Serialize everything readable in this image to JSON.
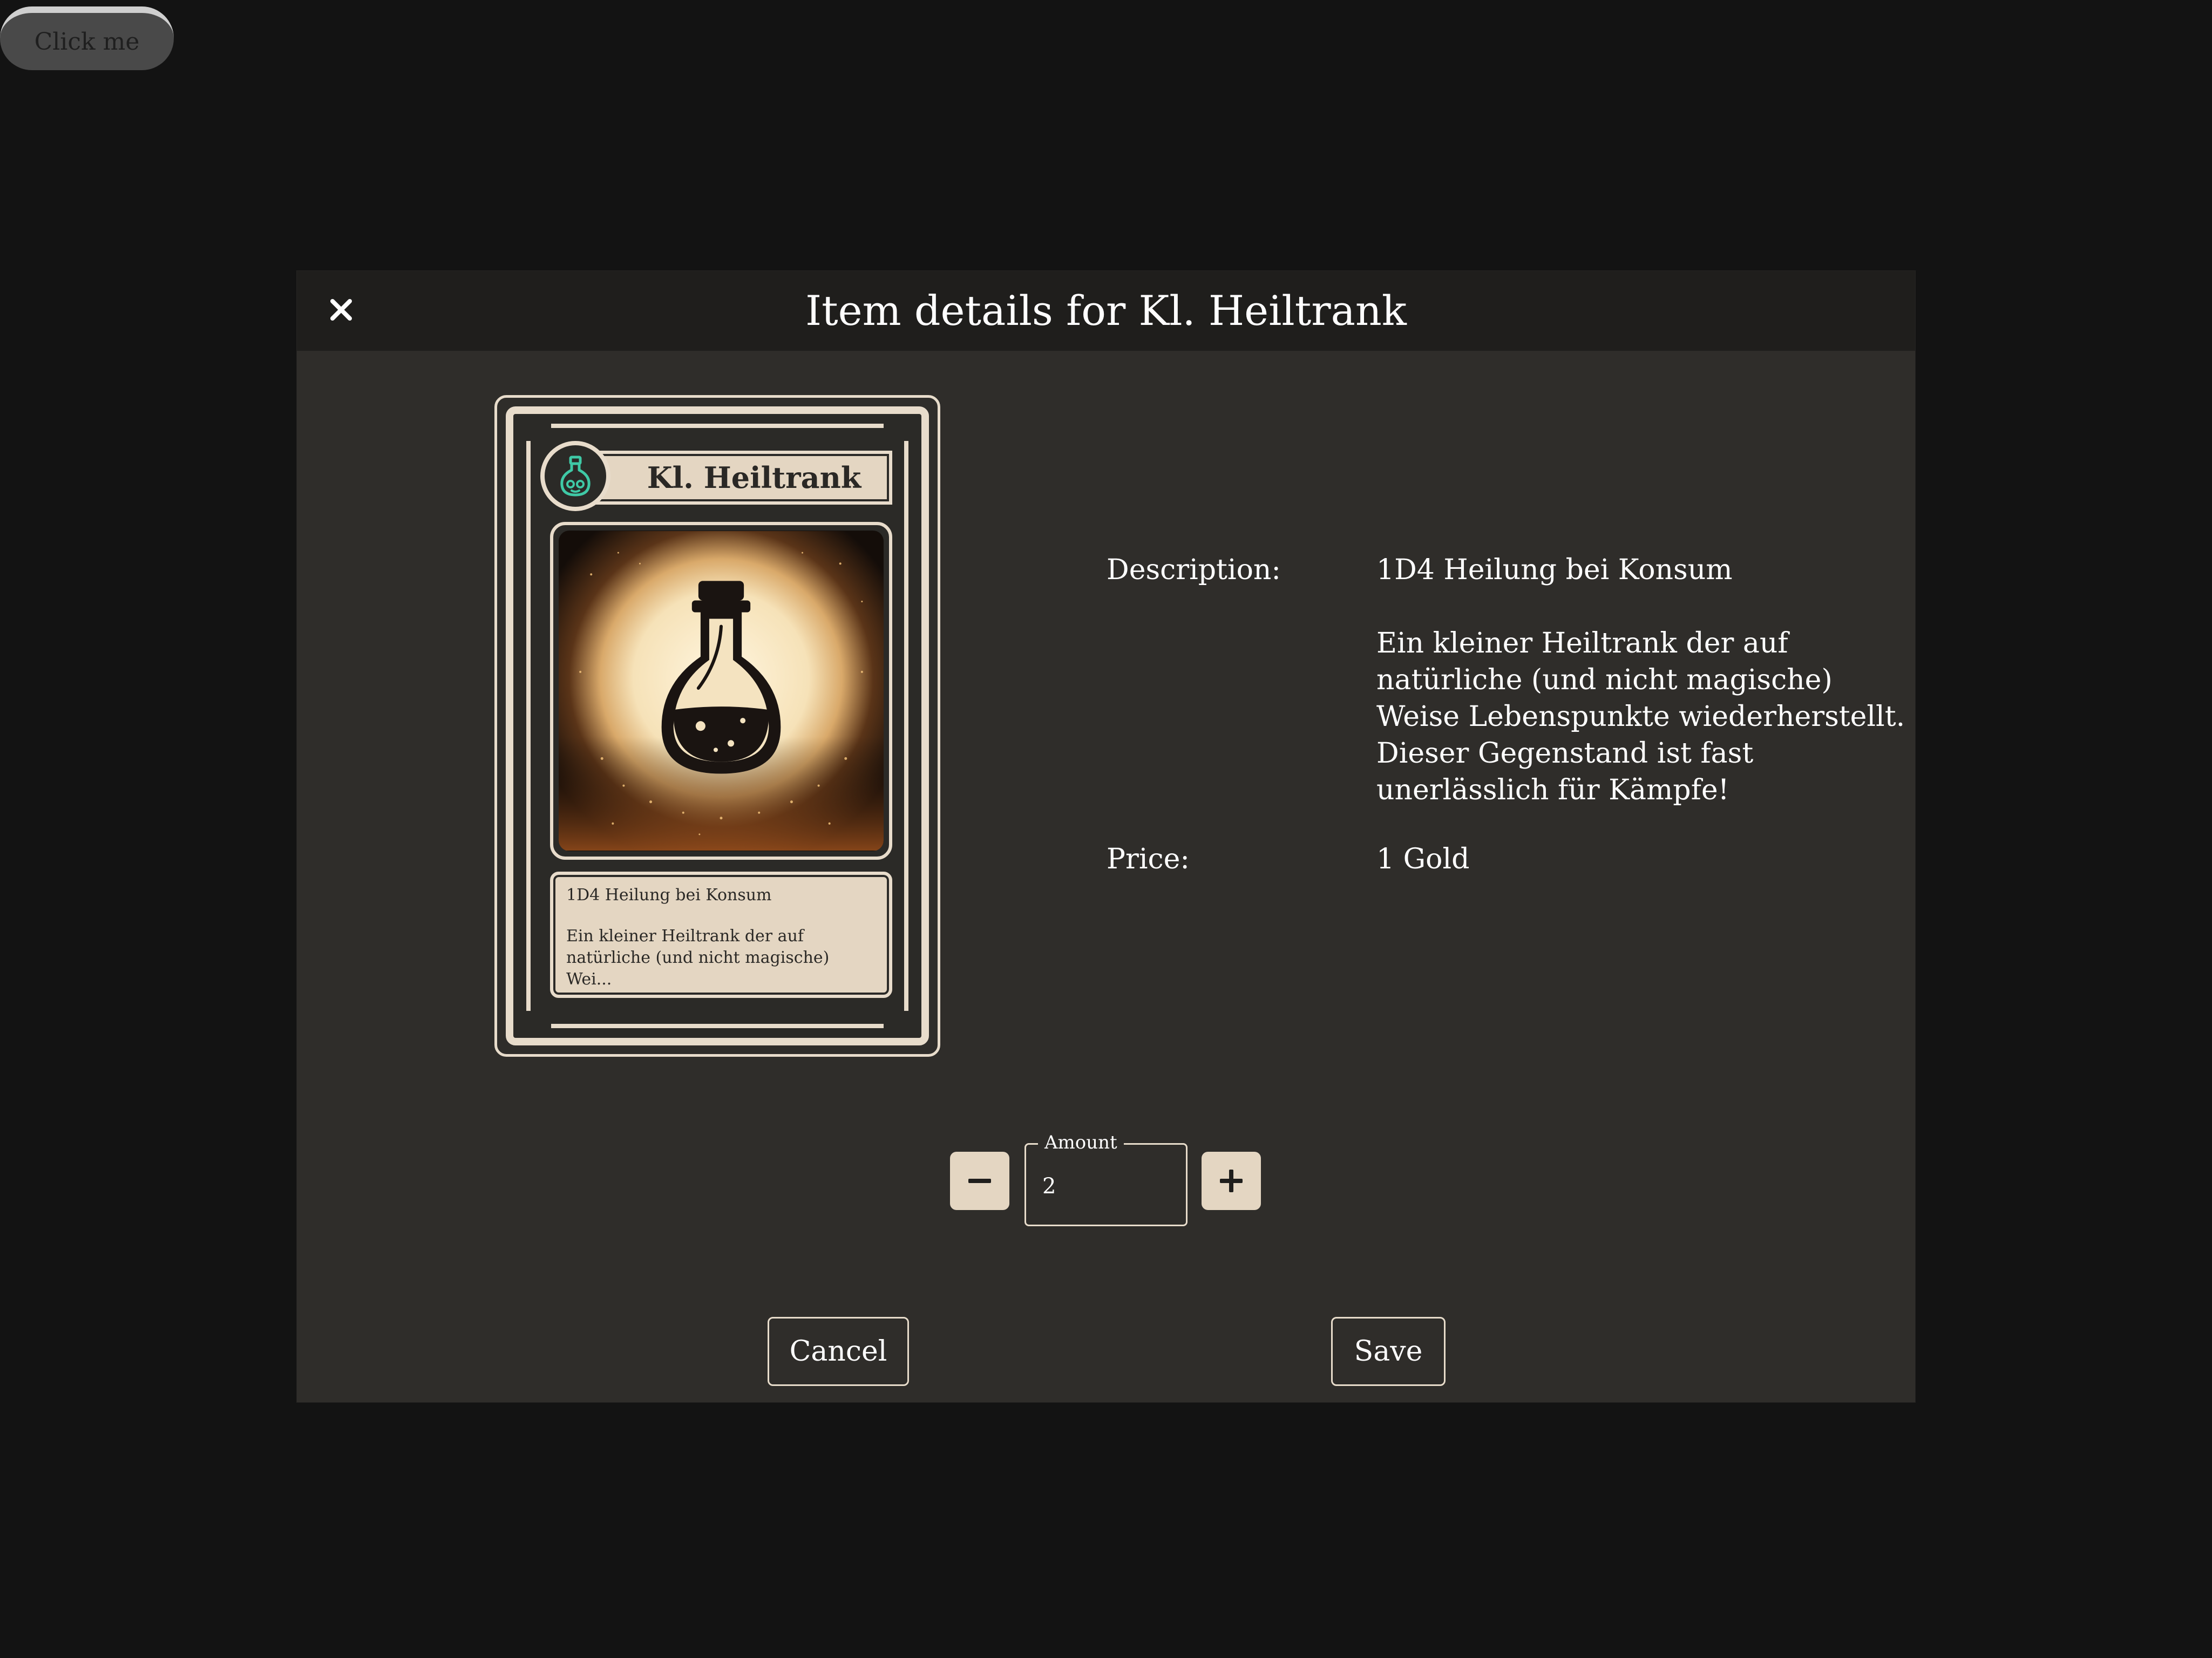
{
  "top_button": {
    "label": "Click me"
  },
  "modal": {
    "title": "Item details for Kl. Heiltrank",
    "close_icon": "close-icon"
  },
  "card": {
    "name": "Kl. Heiltrank",
    "icon": "potion-icon",
    "art": "potion-bottle-illustration",
    "desc_line1": "1D4 Heilung bei Konsum",
    "desc_line2": "Ein kleiner Heiltrank der auf",
    "desc_line3": "natürliche (und nicht magische) Wei..."
  },
  "details": {
    "description_label": "Description:",
    "description_short": "1D4 Heilung bei Konsum",
    "description_long_lines": [
      "Ein kleiner Heiltrank der auf",
      "natürliche (und nicht magische)",
      "Weise Lebenspunkte wiederherstellt.",
      "Dieser Gegenstand ist fast",
      "unerlässlich für Kämpfe!"
    ],
    "price_label": "Price:",
    "price_value": "1 Gold"
  },
  "amount": {
    "label": "Amount",
    "value": "2",
    "minus_icon": "minus-icon",
    "plus_icon": "plus-icon"
  },
  "actions": {
    "cancel_label": "Cancel",
    "save_label": "Save"
  },
  "colors": {
    "page_background": "#131313",
    "modal_background": "#2f2d2a",
    "header_background": "#1f1e1c",
    "card_parchment": "#e4d6c2",
    "potion_icon_accent": "#3fc9a6"
  }
}
